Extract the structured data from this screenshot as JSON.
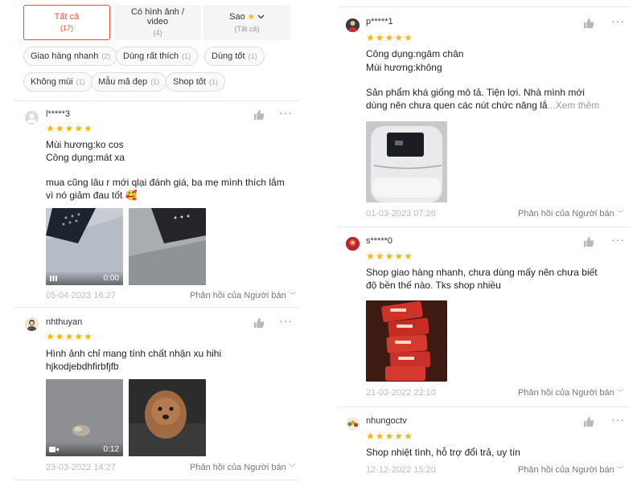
{
  "filter_tabs": [
    {
      "label": "Tất cả",
      "count": "(17)"
    },
    {
      "label": "Có hình ảnh / video",
      "count": "(4)"
    },
    {
      "label": "Sao",
      "count": "(Tất cả)"
    }
  ],
  "chips": [
    {
      "label": "Giao hàng nhanh",
      "count": "(2)"
    },
    {
      "label": "Dùng rất thích",
      "count": "(1)"
    },
    {
      "label": "Dùng tốt",
      "count": "(1)"
    },
    {
      "label": "Không mùi",
      "count": "(1)"
    },
    {
      "label": "Mẫu mã đẹp",
      "count": "(1)"
    },
    {
      "label": "Shop tốt",
      "count": "(1)"
    }
  ],
  "stars": "★★★★★",
  "reply_label": "Phản hồi của Người bán",
  "more_label": "···",
  "left_reviews": [
    {
      "username": "l*****3",
      "lines": [
        "Mùi hương:ko cos",
        "Công dụng:mát xa",
        "mua cũng lâu r mới qlại đánh giá, ba mẹ mình thích lắm",
        "vì nó giảm đau tốt 🥰"
      ],
      "video_time": "0:00",
      "date": "05-04-2023 16:27"
    },
    {
      "username": "nhthuyan",
      "lines": [
        "Hình ảnh chỉ mang tính chất nhận xu hihi",
        "hjkodjebdhfirbfjfb"
      ],
      "video_time": "0:12",
      "date": "23-03-2022 14:27"
    }
  ],
  "right_reviews": [
    {
      "username": "p*****1",
      "lines": [
        "Công dụng:ngâm chân",
        "Mùi hương:không",
        "Sản phẩm khá giống mô tả. Tiện lợi. Nhà mình mới",
        "dùng nên chưa quen các nút chức năng lắ"
      ],
      "see_more": "...Xem thêm",
      "date": "01-03-2023 07:26"
    },
    {
      "username": "s*****0",
      "lines": [
        "Shop giao hàng nhanh, chưa dùng mấy nên chưa biết",
        "độ bền thế nào. Tks shop nhiều"
      ],
      "date": "21-03-2022 22:10"
    },
    {
      "username": "nhungoctv",
      "lines": [
        "Shop nhiệt tình, hỗ trợ đổi trả, uy tín"
      ],
      "date": "12-12-2022 15:20"
    }
  ]
}
